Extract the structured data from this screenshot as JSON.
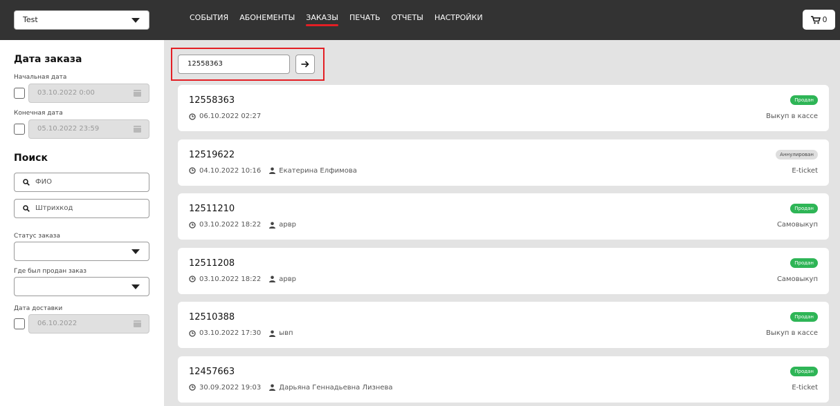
{
  "header": {
    "venue_select": "Test",
    "nav": [
      "СОБЫТИЯ",
      "АБОНЕМЕНТЫ",
      "ЗАКАЗЫ",
      "ПЕЧАТЬ",
      "ОТЧЕТЫ",
      "НАСТРОЙКИ"
    ],
    "active_nav": "ЗАКАЗЫ",
    "cart_count": "0"
  },
  "sidebar": {
    "order_date_title": "Дата заказа",
    "start_date_label": "Начальная дата",
    "start_date_value": "03.10.2022 0:00",
    "end_date_label": "Конечная дата",
    "end_date_value": "05.10.2022 23:59",
    "search_title": "Поиск",
    "fio_placeholder": "ФИО",
    "barcode_placeholder": "Штрихкод",
    "status_label": "Статус заказа",
    "sold_where_label": "Где был продан заказ",
    "delivery_date_label": "Дата доставки",
    "delivery_date_value": "06.10.2022"
  },
  "main": {
    "search_value": "12558363",
    "orders": [
      {
        "number": "12558363",
        "datetime": "06.10.2022 02:27",
        "customer": "",
        "status": "Продан",
        "status_type": "sold",
        "delivery": "Выкуп в кассе"
      },
      {
        "number": "12519622",
        "datetime": "04.10.2022 10:16",
        "customer": "Екатерина Елфимова",
        "status": "Аннулирован",
        "status_type": "cancel",
        "delivery": "E-ticket"
      },
      {
        "number": "12511210",
        "datetime": "03.10.2022 18:22",
        "customer": "арвр",
        "status": "Продан",
        "status_type": "sold",
        "delivery": "Самовыкуп"
      },
      {
        "number": "12511208",
        "datetime": "03.10.2022 18:22",
        "customer": "арвр",
        "status": "Продан",
        "status_type": "sold",
        "delivery": "Самовыкуп"
      },
      {
        "number": "12510388",
        "datetime": "03.10.2022 17:30",
        "customer": "ывп",
        "status": "Продан",
        "status_type": "sold",
        "delivery": "Выкуп в кассе"
      },
      {
        "number": "12457663",
        "datetime": "30.09.2022 19:03",
        "customer": "Дарьяна Геннадьевна Лизнева",
        "status": "Продан",
        "status_type": "sold",
        "delivery": "E-ticket"
      }
    ]
  },
  "colors": {
    "accent": "#e31e24",
    "header_bg": "#333333",
    "sold": "#2eb556"
  }
}
